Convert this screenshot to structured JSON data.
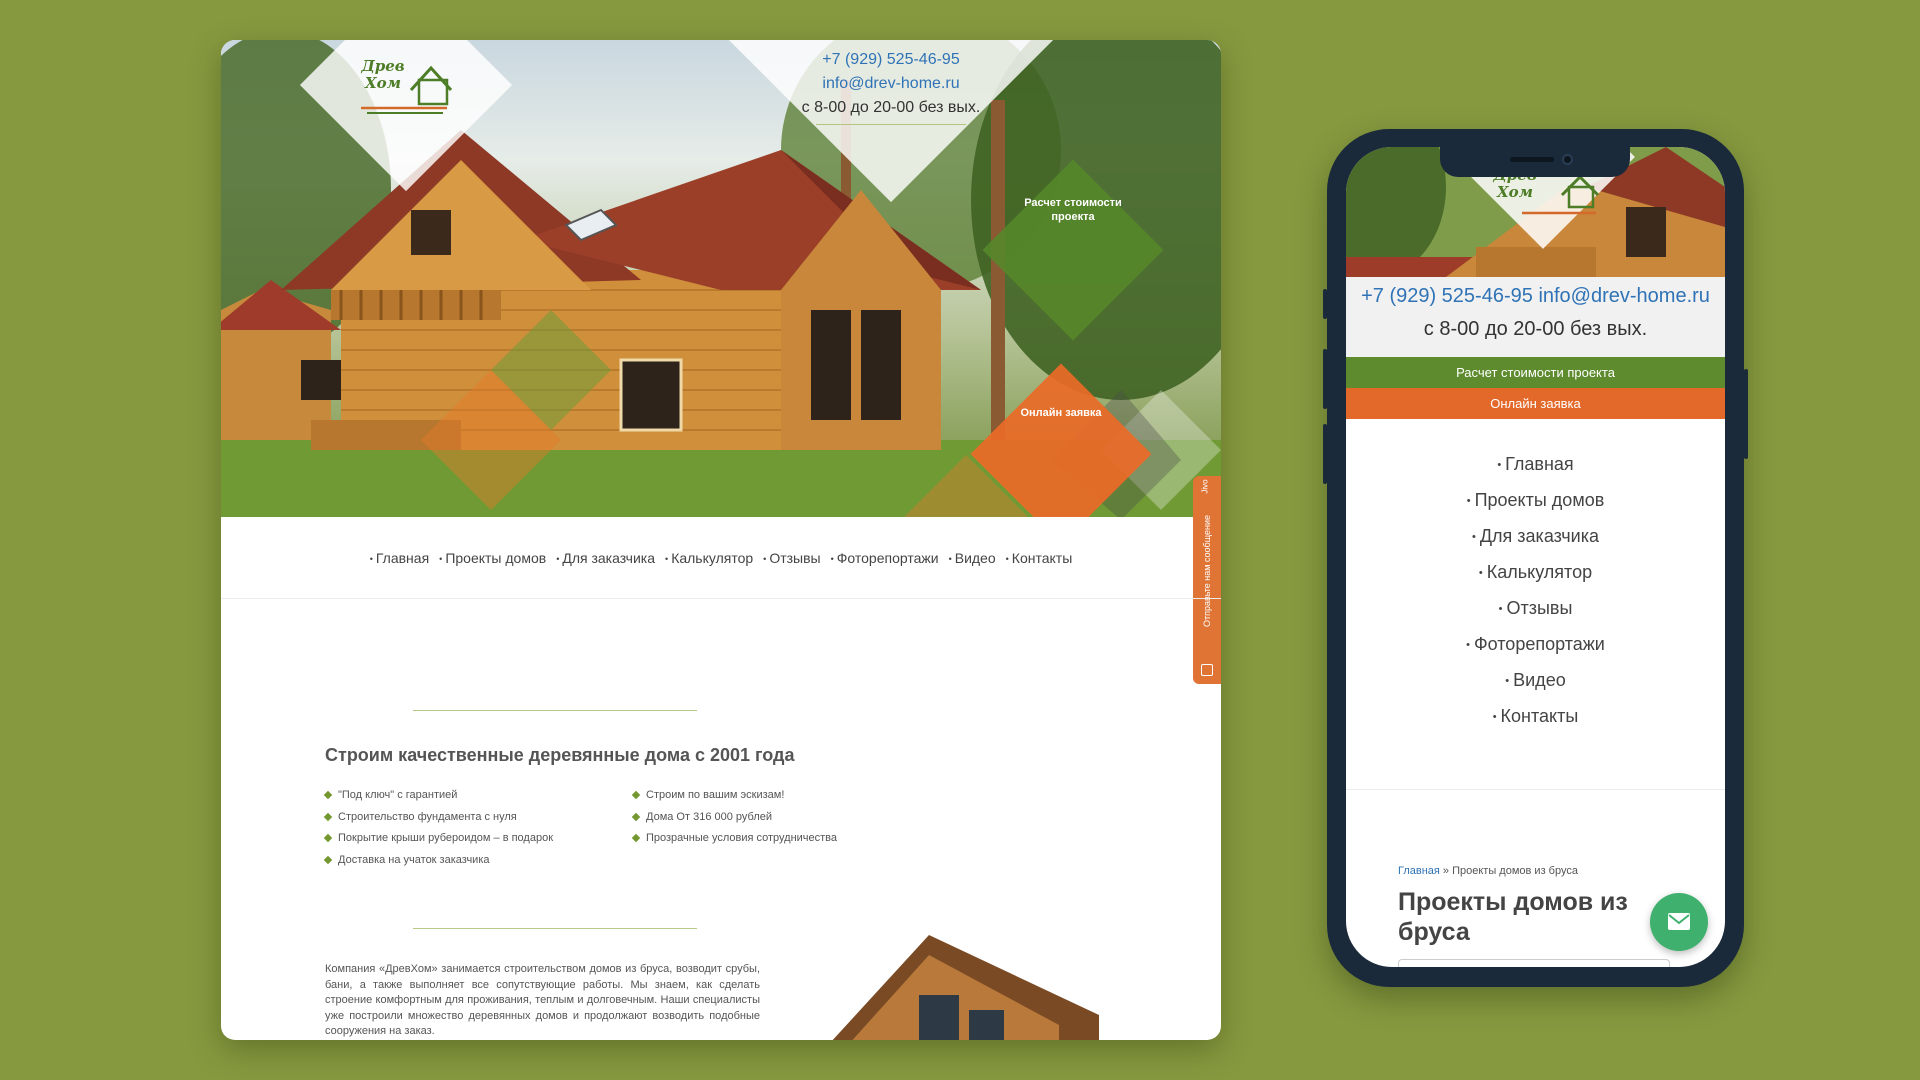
{
  "desktop": {
    "logo": {
      "text_line1": "Древ",
      "text_line2": "Хом"
    },
    "contacts": {
      "phone": "+7 (929) 525-46-95",
      "email": "info@drev-home.ru",
      "hours": "с 8-00 до 20-00 без вых."
    },
    "cta": {
      "calc_label": "Расчет стоимости проекта",
      "online_label": "Онлайн заявка"
    },
    "feedback_tab": "Отправьте нам сообщение",
    "feedback_tab_extra": "Jivo",
    "nav": [
      "Главная",
      "Проекты домов",
      "Для заказчика",
      "Калькулятор",
      "Отзывы",
      "Фоторепортажи",
      "Видео",
      "Контакты"
    ],
    "section_heading": "Строим качественные деревянные дома с 2001 года",
    "features_left": [
      "\"Под ключ\" с гарантией",
      "Строительство фундамента с нуля",
      "Покрытие крыши рубероидом – в подарок",
      "Доставка на учаток заказчика"
    ],
    "features_right": [
      "Строим по вашим эскизам!",
      "Дома От 316 000 рублей",
      "Прозрачные условия сотрудничества"
    ],
    "about": "Компания «ДревХом» занимается строительством домов из бруса, возводит срубы, бани, а также выполняет все сопутствующие работы. Мы знаем, как сделать строение комфортным для проживания, теплым и долговечным. Наши специалисты уже построили множество деревянных домов и продолжают возводить подобные сооружения на заказ."
  },
  "mobile": {
    "logo": {
      "text_line1": "Древ",
      "text_line2": "Хом"
    },
    "phone": "+7 (929) 525-46-95",
    "email": "info@drev-home.ru",
    "hours": "с 8-00 до 20-00 без вых.",
    "calc_button": "Расчет стоимости проекта",
    "online_button": "Онлайн заявка",
    "nav": [
      "Главная",
      "Проекты домов",
      "Для заказчика",
      "Калькулятор",
      "Отзывы",
      "Фоторепортажи",
      "Видео",
      "Контакты"
    ],
    "breadcrumb_home": "Главная",
    "breadcrumb_sep": " » ",
    "breadcrumb_current": "Проекты домов из бруса",
    "page_title": "Проекты домов из бруса",
    "fab_icon": "mail-icon"
  },
  "colors": {
    "background": "#86993f",
    "green_accent": "#5d8b2e",
    "orange_accent": "#e3692a",
    "link": "#2f73b6",
    "fab": "#3fb06e"
  }
}
